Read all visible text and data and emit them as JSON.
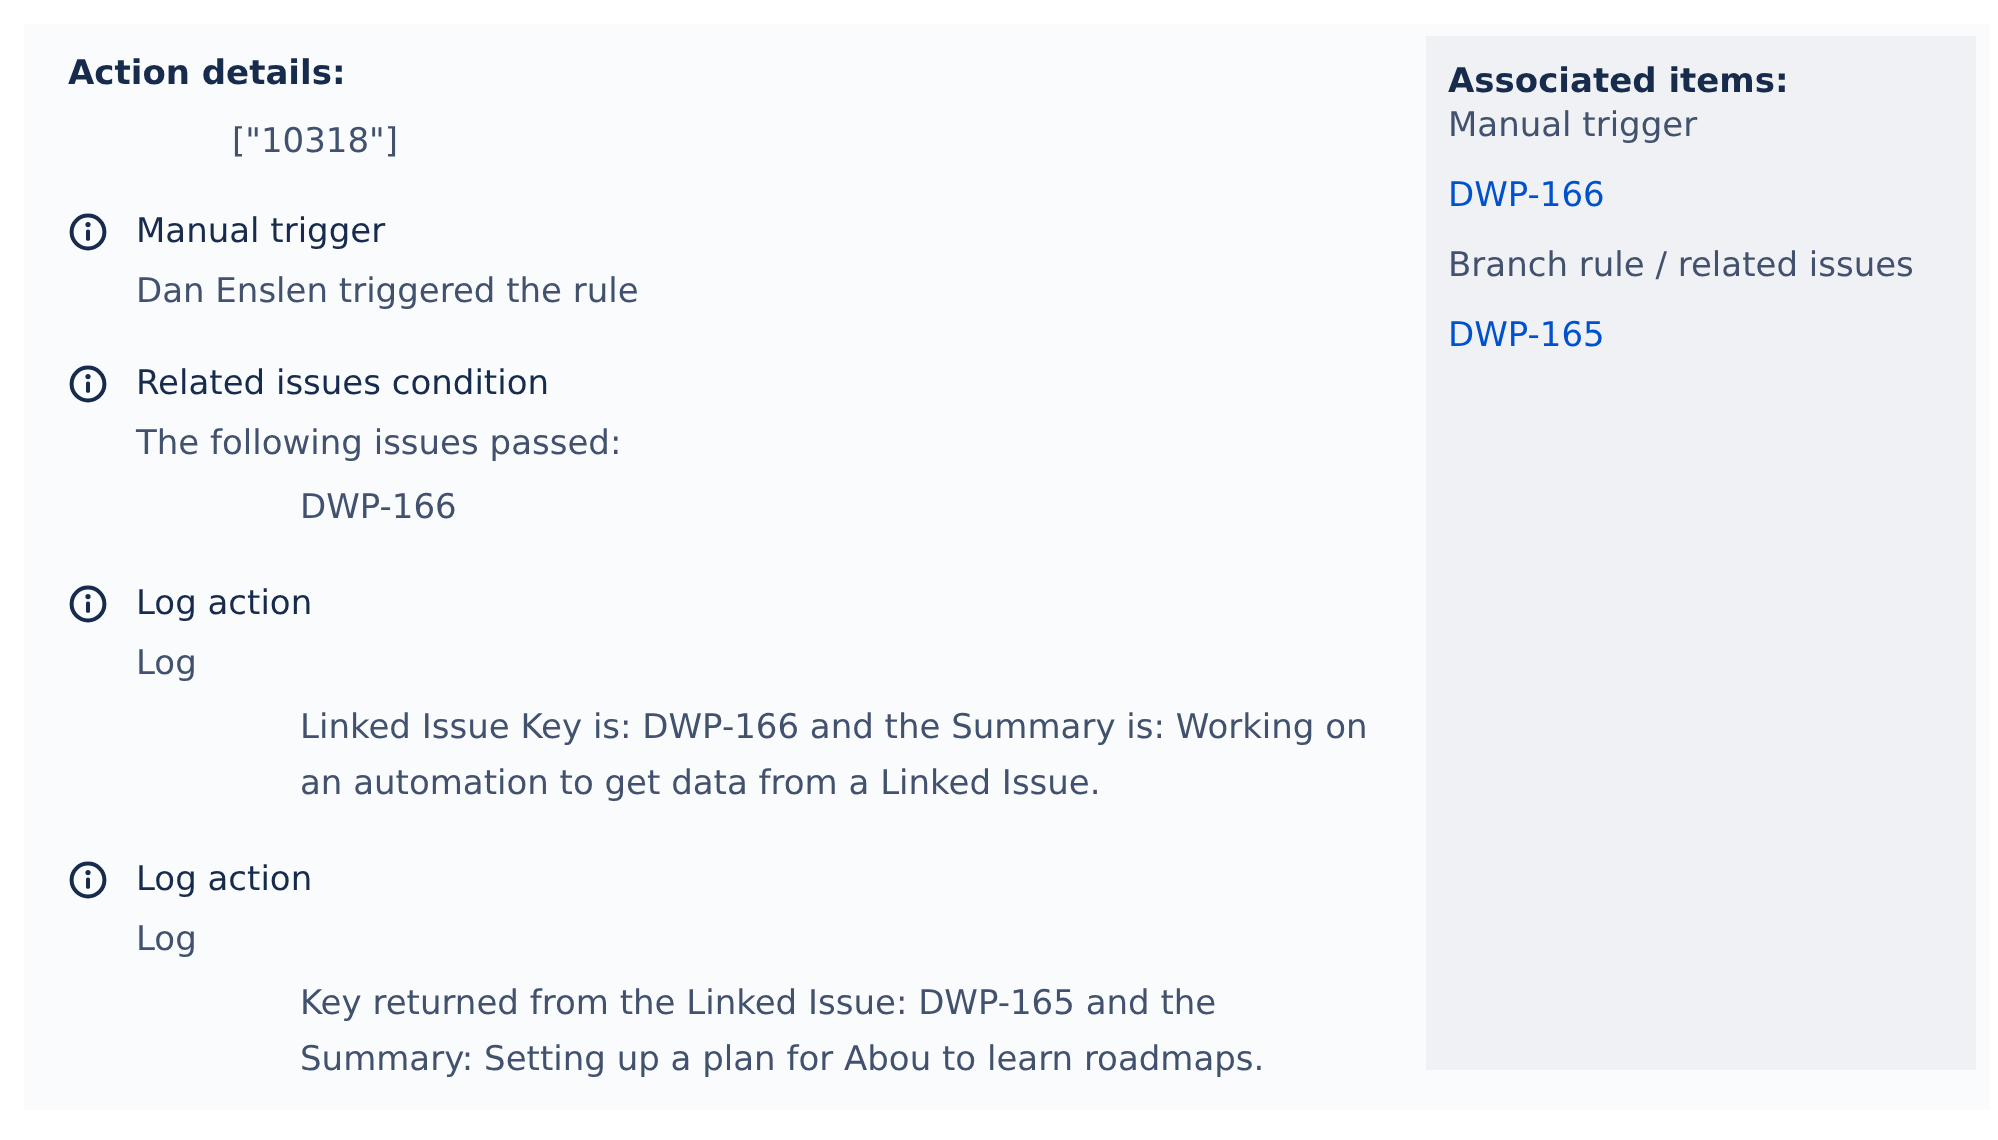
{
  "action_details": {
    "title": "Action details:",
    "value": "[\"10318\"]"
  },
  "entries": [
    {
      "title": "Manual trigger",
      "description": "Dan Enslen triggered the rule"
    },
    {
      "title": "Related issues condition",
      "description": "The following issues passed:",
      "details": [
        "DWP-166"
      ]
    },
    {
      "title": "Log action",
      "description": "Log",
      "details": [
        "Linked Issue Key is: DWP-166 and the Summary is: Working on an automation to get data from a Linked Issue."
      ]
    },
    {
      "title": "Log action",
      "description": "Log",
      "details": [
        "Key returned from the Linked Issue: DWP-165 and the Summary: Setting up a plan for Abou to learn roadmaps."
      ]
    }
  ],
  "associated_items": {
    "title": "Associated items:",
    "items": [
      {
        "kind": "text",
        "label": "Manual trigger"
      },
      {
        "kind": "link",
        "label": "DWP-166"
      },
      {
        "kind": "text",
        "label": "Branch rule / related issues"
      },
      {
        "kind": "link",
        "label": "DWP-165"
      }
    ]
  }
}
